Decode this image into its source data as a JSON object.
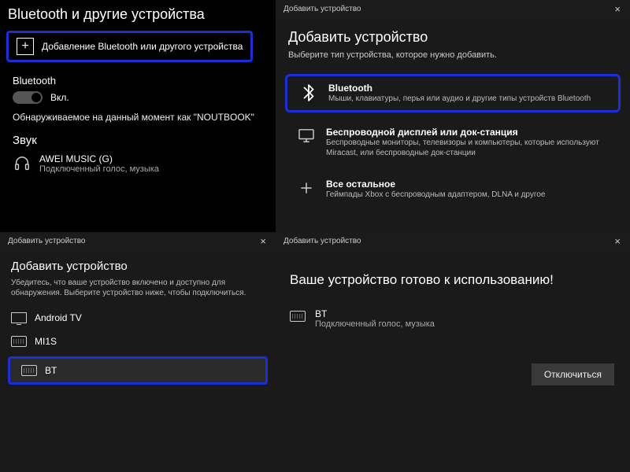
{
  "panel1": {
    "title": "Bluetooth и другие устройства",
    "add_device_label": "Добавление Bluetooth или другого устройства",
    "bluetooth_label": "Bluetooth",
    "toggle_state": "Вкл.",
    "discoverable": "Обнаруживаемое на данный момент как \"NOUTBOOK\"",
    "sound_header": "Звук",
    "device": {
      "name": "AWEI MUSIC (G)",
      "sub": "Подключенный голос, музыка"
    }
  },
  "panel2": {
    "window_title": "Добавить устройство",
    "title": "Добавить устройство",
    "subtitle": "Выберите тип устройства, которое нужно добавить.",
    "options": [
      {
        "title": "Bluetooth",
        "sub": "Мыши, клавиатуры, перья или аудио и другие типы устройств Bluetooth"
      },
      {
        "title": "Беспроводной дисплей или док-станция",
        "sub": "Беспроводные мониторы, телевизоры и компьютеры, которые используют Miracast, или беспроводные док-станции"
      },
      {
        "title": "Все остальное",
        "sub": "Геймпады Xbox с беспроводным адаптером, DLNA и другое"
      }
    ]
  },
  "panel3": {
    "window_title": "Добавить устройство",
    "title": "Добавить устройство",
    "subtitle": "Убедитесь, что ваше устройство включено и доступно для обнаружения. Выберите устройство ниже, чтобы подключиться.",
    "devices": [
      "Android TV",
      "MI1S",
      "BT"
    ]
  },
  "panel4": {
    "window_title": "Добавить устройство",
    "title": "Ваше устройство готово к использованию!",
    "device": {
      "name": "BT",
      "sub": "Подключенный голос, музыка"
    },
    "disconnect": "Отключиться"
  },
  "colors": {
    "highlight": "#1a2fd6"
  }
}
